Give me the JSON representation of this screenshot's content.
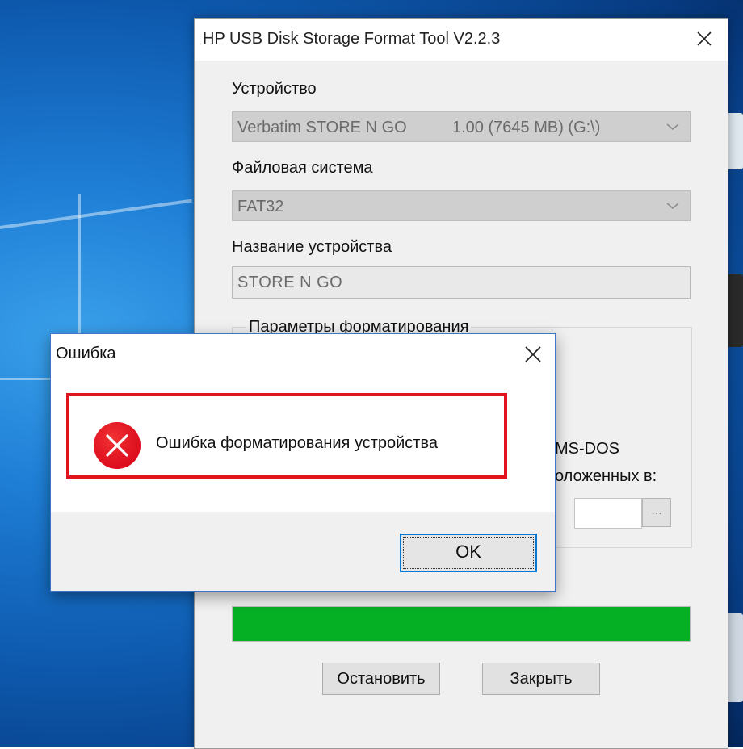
{
  "window": {
    "title": "HP USB Disk Storage Format Tool V2.2.3",
    "device_label": "Устройство",
    "device_name": "Verbatim STORE N GO",
    "device_detail": "1.00 (7645 MB) (G:\\)",
    "fs_label": "Файловая система",
    "fs_value": "FAT32",
    "volume_label": "Название устройства",
    "volume_value": "STORE N GO",
    "options_group": "Параметры форматирования",
    "option_msdos_partial": "MS-DOS",
    "option_path_partial": "оложенных в:",
    "browse_label": "...",
    "progress_fraction": 1.0,
    "stop_button": "Остановить",
    "close_button": "Закрыть"
  },
  "dialog": {
    "title": "Ошибка",
    "message": "Ошибка форматирования устройства",
    "ok_button": "OK"
  },
  "colors": {
    "progress": "#06b025",
    "highlight": "#e0131b",
    "error_icon": "#e81123",
    "accent": "#0078d7"
  },
  "icons": [
    "close-icon",
    "chevron-down-icon",
    "error-icon"
  ]
}
